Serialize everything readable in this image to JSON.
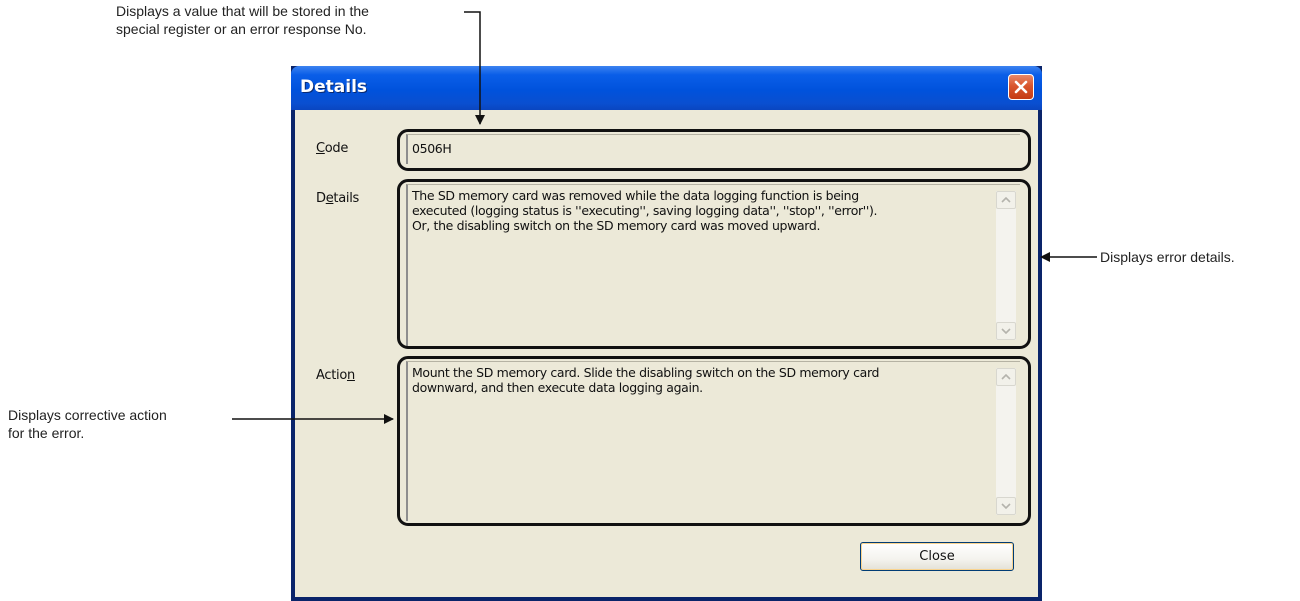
{
  "annotations": {
    "top": [
      "Displays a value that will be stored in the",
      "special register or an error response No."
    ],
    "right": [
      "Displays error details."
    ],
    "left": [
      "Displays corrective action",
      "for the error."
    ]
  },
  "dialog": {
    "title": "Details",
    "close_icon": "close-x-icon",
    "code": {
      "label_pre": "",
      "label_u": "C",
      "label_post": "ode",
      "value": "0506H"
    },
    "details": {
      "label_pre": "D",
      "label_u": "e",
      "label_post": "tails",
      "lines": [
        "The SD memory card was removed while the data logging function is being",
        "executed (logging status is ''executing'', saving logging data'', ''stop'', ''error'').",
        "Or, the disabling switch on the SD memory card was moved upward."
      ]
    },
    "action": {
      "label_pre": "Actio",
      "label_u": "n",
      "label_post": "",
      "lines": [
        "Mount the SD memory card. Slide the disabling switch on the SD memory card",
        "downward, and then execute data logging again."
      ]
    },
    "close_label": "Close"
  },
  "colors": {
    "titlebar": "#0052dc",
    "client": "#ece9d8",
    "close_x": "#d9562e"
  }
}
